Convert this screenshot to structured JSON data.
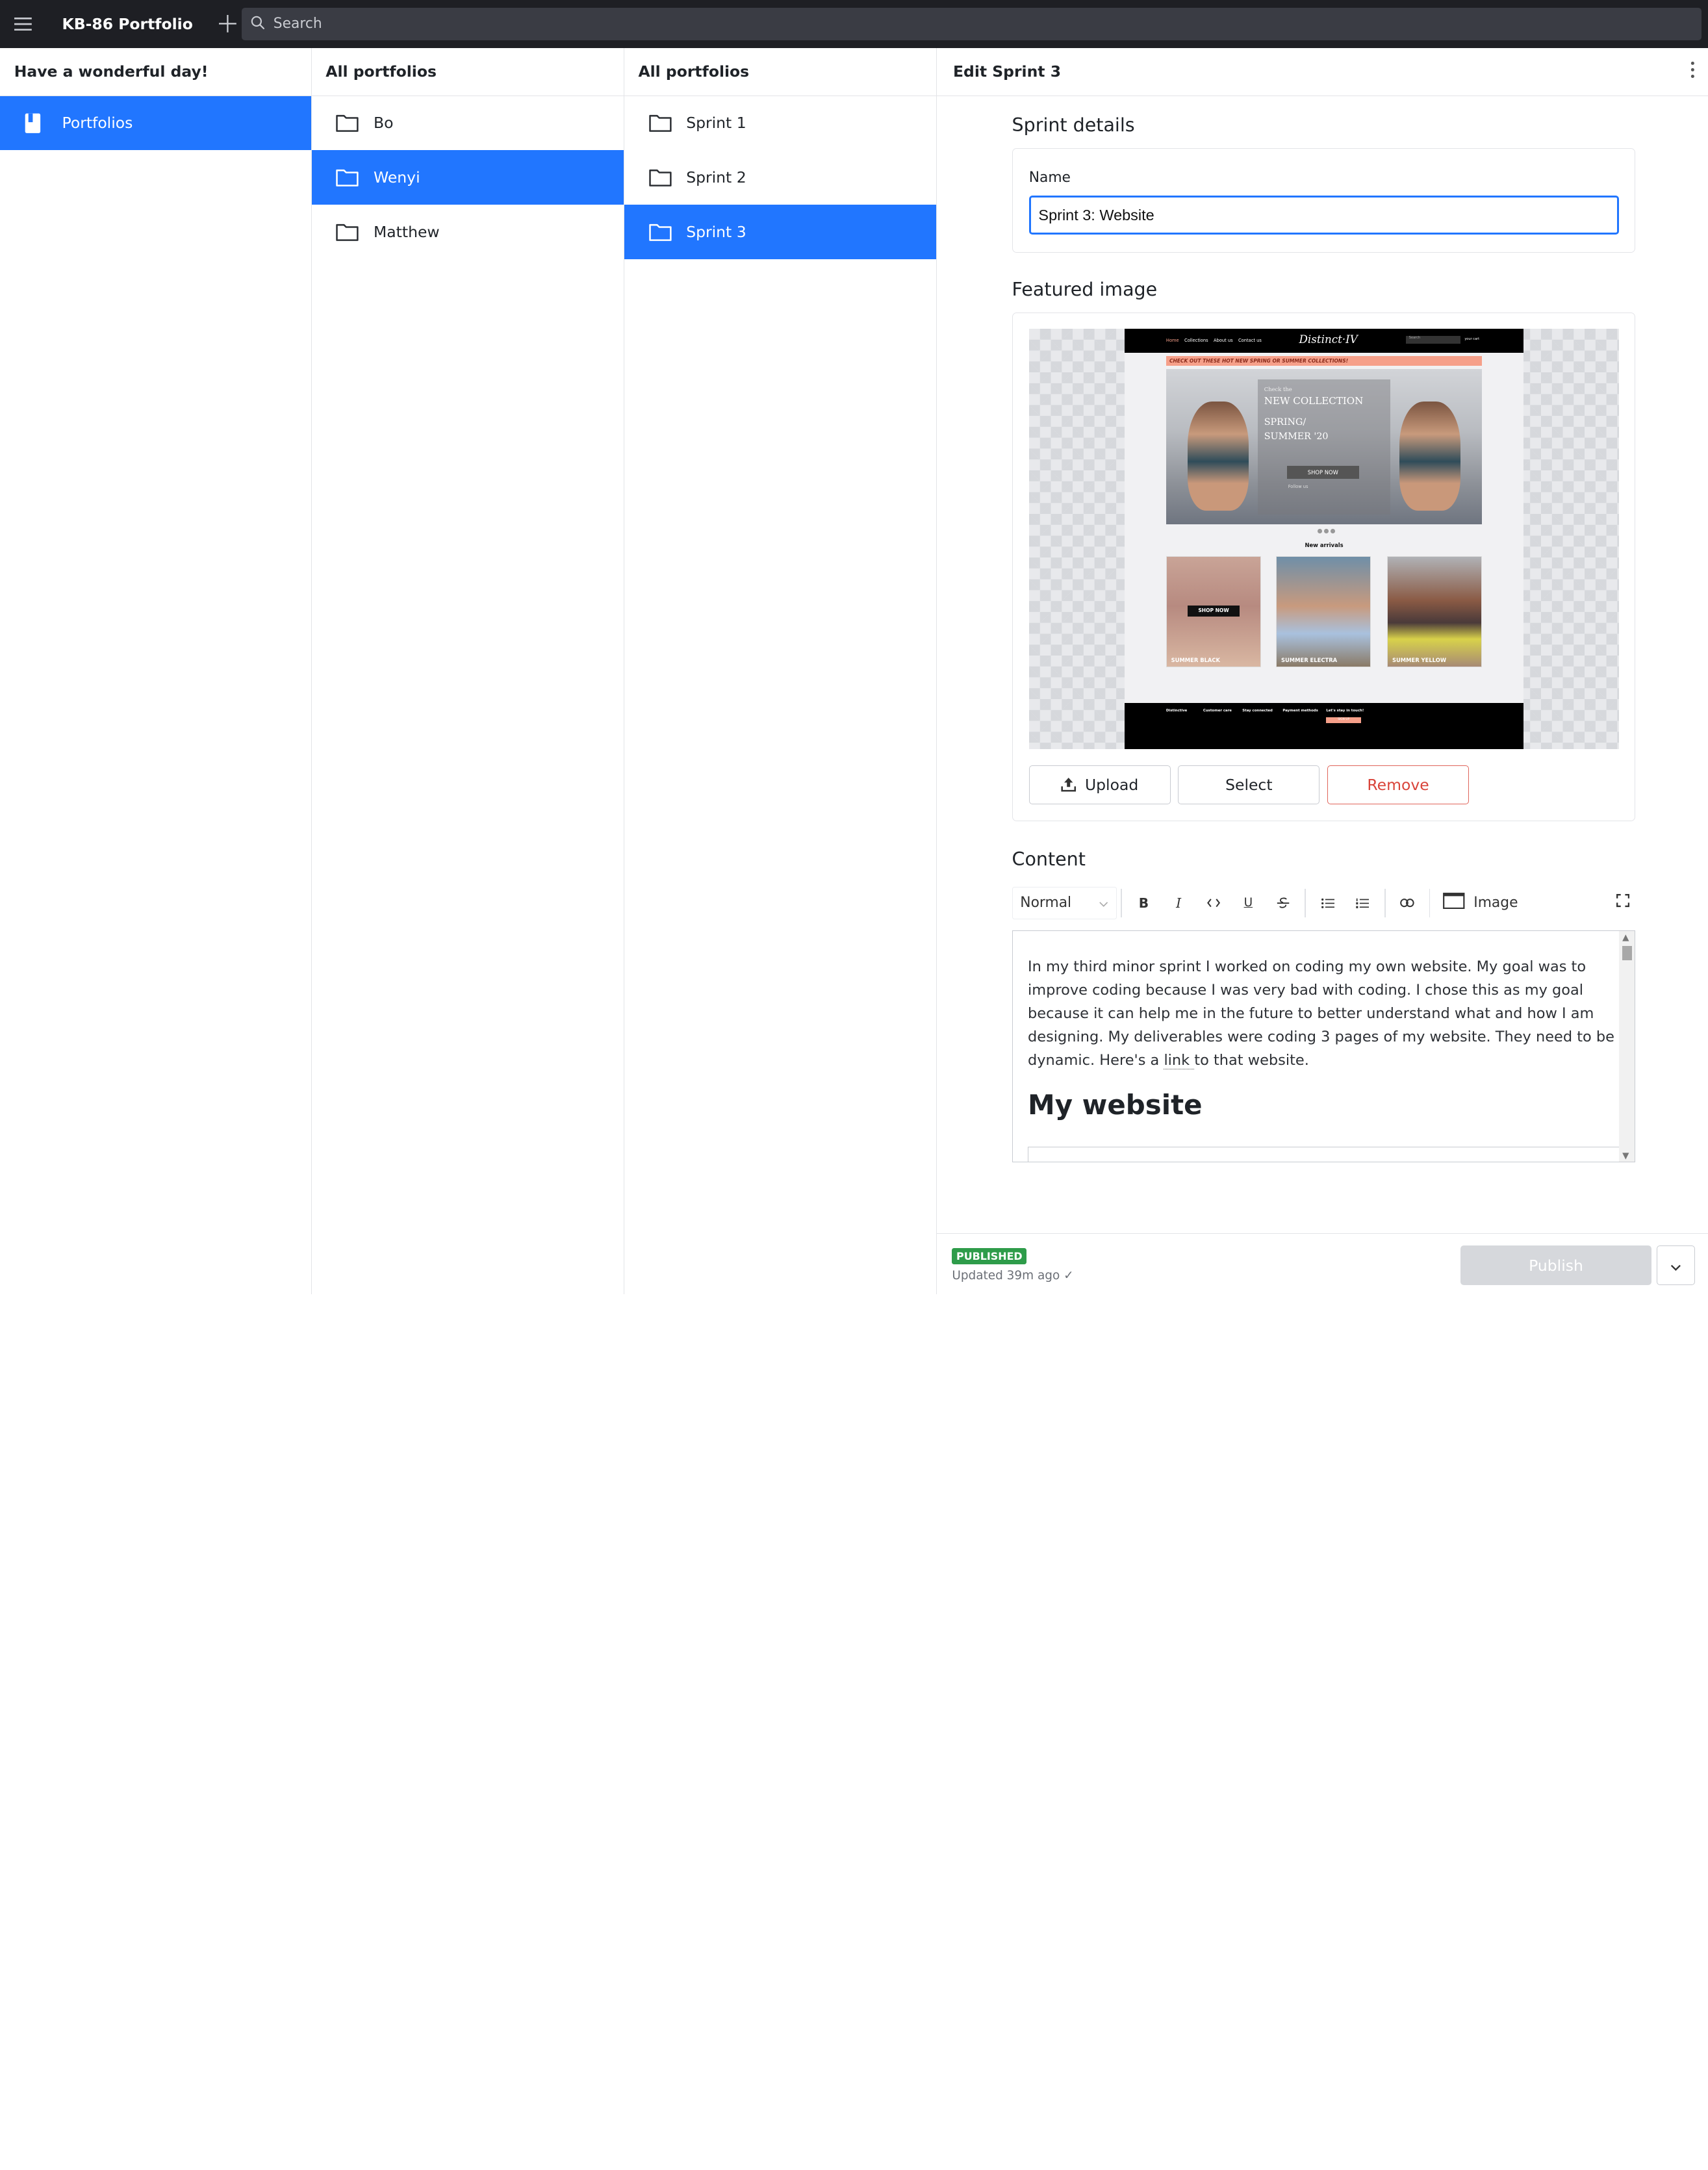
{
  "topbar": {
    "app_title": "KB-86 Portfolio",
    "search_placeholder": "Search"
  },
  "nav_pane": {
    "greeting": "Have a wonderful day!",
    "items": [
      {
        "label": "Portfolios",
        "icon": "book-icon",
        "active": true
      }
    ]
  },
  "portfolios_pane": {
    "title": "All portfolios",
    "items": [
      {
        "label": "Bo",
        "icon": "folder-icon",
        "active": false
      },
      {
        "label": "Wenyi",
        "icon": "folder-icon",
        "active": true
      },
      {
        "label": "Matthew",
        "icon": "folder-icon",
        "active": false
      }
    ]
  },
  "sprints_pane": {
    "title": "All portfolios",
    "items": [
      {
        "label": "Sprint 1",
        "icon": "folder-icon",
        "active": false
      },
      {
        "label": "Sprint 2",
        "icon": "folder-icon",
        "active": false
      },
      {
        "label": "Sprint 3",
        "icon": "folder-icon",
        "active": true
      }
    ]
  },
  "editor": {
    "title": "Edit Sprint 3",
    "details": {
      "section_title": "Sprint details",
      "name_label": "Name",
      "name_value": "Sprint 3: Website"
    },
    "featured": {
      "section_title": "Featured image",
      "upload_label": "Upload",
      "select_label": "Select",
      "remove_label": "Remove",
      "preview": {
        "nav_links": [
          "Home",
          "Collections",
          "About us",
          "Contact us"
        ],
        "logo": "Distinct·IV",
        "search": "Search",
        "cart": "your cart",
        "promo": "CHECK OUT THESE HOT NEW SPRING OR SUMMER COLLECTIONS!",
        "hero_kicker": "Check the",
        "hero_title": "NEW COLLECTION",
        "hero_sub": "SPRING/ SUMMER '20",
        "hero_button": "SHOP NOW",
        "hero_follow": "Follow us",
        "arrivals": "New arrivals",
        "products": [
          {
            "label": "SUMMER BLACK",
            "button": "SHOP NOW"
          },
          {
            "label": "SUMMER ELECTRA",
            "button": ""
          },
          {
            "label": "SUMMER YELLOW",
            "button": ""
          }
        ],
        "footer_cols": [
          "Distinctive",
          "Customer care",
          "Stay connected",
          "Payment methods",
          "Let's stay in touch!"
        ],
        "footer_cta": "SIGN UP"
      }
    },
    "content": {
      "section_title": "Content",
      "format_value": "Normal",
      "image_label": "Image",
      "para_before_link": "In my third minor sprint I worked on coding my own website. My goal was to improve coding because I was very bad with coding. I chose this as my goal because it can help me in the future to better understand what and how I am designing. My deliverables were coding 3 pages of my website. They need to be dynamic. Here's a ",
      "link_text": "link ",
      "para_after_link": "to that website.",
      "heading": "My website"
    },
    "status": {
      "badge": "PUBLISHED",
      "updated": "Updated 39m ago ✓",
      "publish_label": "Publish"
    }
  },
  "colors": {
    "accent": "#2176ff",
    "topbar": "#1e1f24",
    "published": "#2e9c4a",
    "remove": "#d9443a"
  }
}
